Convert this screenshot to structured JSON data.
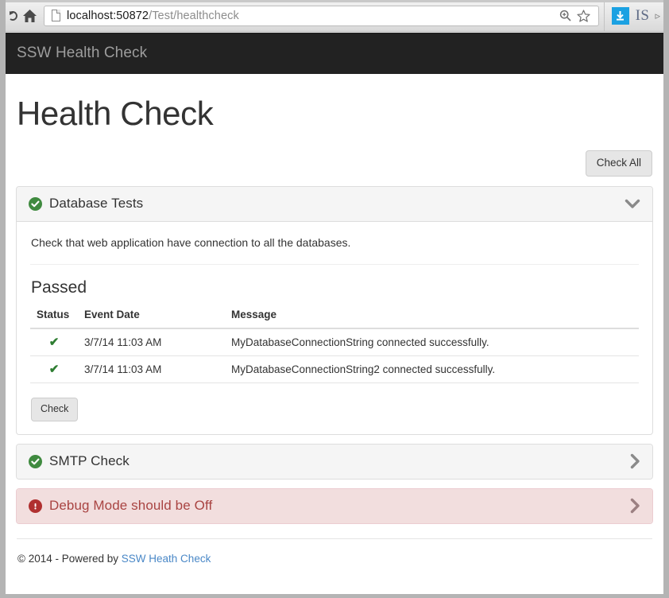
{
  "browser": {
    "url_host": "localhost:50872",
    "url_path": "/Test/healthcheck",
    "extension_label": "IS",
    "icons": {
      "home": "home-icon",
      "page": "page-icon",
      "zoom": "zoom-icon",
      "bookmark": "star-icon",
      "download": "download-icon"
    }
  },
  "navbar": {
    "brand": "SSW Health Check"
  },
  "page": {
    "title": "Health Check",
    "check_all_label": "Check All"
  },
  "panels": [
    {
      "id": "database-tests",
      "title": "Database Tests",
      "state": "expanded",
      "status": "ok",
      "chevron": "chevron-down-icon",
      "description": "Check that web application have connection to all the databases.",
      "section_title": "Passed",
      "table": {
        "headers": [
          "Status",
          "Event Date",
          "Message"
        ],
        "rows": [
          {
            "status": "✔",
            "date": "3/7/14 11:03 AM",
            "message": "MyDatabaseConnectionString connected successfully."
          },
          {
            "status": "✔",
            "date": "3/7/14 11:03 AM",
            "message": "MyDatabaseConnectionString2 connected successfully."
          }
        ]
      },
      "check_label": "Check"
    },
    {
      "id": "smtp-check",
      "title": "SMTP Check",
      "state": "collapsed",
      "status": "ok",
      "chevron": "chevron-right-icon"
    },
    {
      "id": "debug-mode",
      "title": "Debug Mode should be Off",
      "state": "collapsed",
      "status": "error",
      "chevron": "chevron-right-icon"
    }
  ],
  "footer": {
    "copyright": "© 2014 - Powered by ",
    "link": "SSW Heath Check"
  },
  "colors": {
    "navbar_bg": "#222222",
    "navbar_text": "#9d9d9d",
    "panel_heading_bg": "#f5f5f5",
    "panel_border": "#dddddd",
    "danger_bg": "#f2dede",
    "danger_border": "#ebccd1",
    "danger_text": "#a94442",
    "status_ok": "#3f8a3f",
    "status_error": "#b03030",
    "tick_green": "#2e7d32",
    "link": "#4a88c7",
    "download_blue": "#1ba1e2"
  }
}
